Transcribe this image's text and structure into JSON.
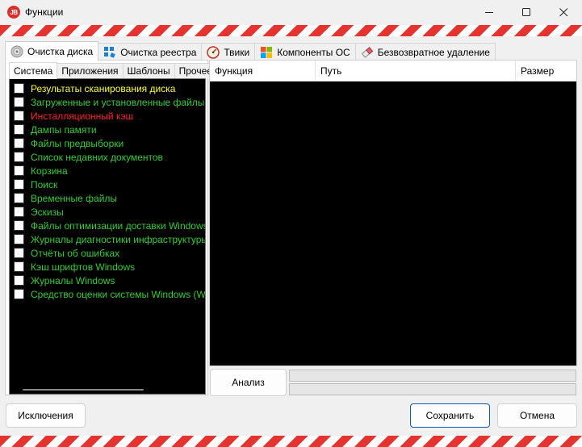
{
  "window": {
    "app_icon_text": "JB",
    "title": "Функции",
    "minimize_glyph": "—",
    "maximize_glyph": "☐",
    "close_glyph": "✕"
  },
  "main_tabs": [
    {
      "label": "Очистка диска",
      "icon": "disk-cleanup-icon",
      "active": true
    },
    {
      "label": "Очистка реестра",
      "icon": "registry-icon",
      "active": false
    },
    {
      "label": "Твики",
      "icon": "gauge-icon",
      "active": false
    },
    {
      "label": "Компоненты ОС",
      "icon": "windows-logo-icon",
      "active": false
    },
    {
      "label": "Безвозвратное удаление",
      "icon": "eraser-icon",
      "active": false
    }
  ],
  "sub_tabs": [
    {
      "label": "Система",
      "active": true
    },
    {
      "label": "Приложения",
      "active": false
    },
    {
      "label": "Шаблоны",
      "active": false
    },
    {
      "label": "Прочее",
      "active": false
    }
  ],
  "check_items": [
    {
      "label": "Результаты сканирования диска",
      "color": "#ffff33",
      "checked": false
    },
    {
      "label": "Загруженные и установленные файлы программ",
      "color": "#33cc33",
      "checked": false
    },
    {
      "label": "Инсталляционный кэш",
      "color": "#ff2222",
      "checked": false
    },
    {
      "label": "Дампы памяти",
      "color": "#33cc33",
      "checked": false
    },
    {
      "label": "Файлы предвыборки",
      "color": "#33cc33",
      "checked": false
    },
    {
      "label": "Список недавних документов",
      "color": "#33cc33",
      "checked": false
    },
    {
      "label": "Корзина",
      "color": "#33cc33",
      "checked": false
    },
    {
      "label": "Поиск",
      "color": "#33cc33",
      "checked": false
    },
    {
      "label": "Временные файлы",
      "color": "#33cc33",
      "checked": false
    },
    {
      "label": "Эскизы",
      "color": "#33cc33",
      "checked": false
    },
    {
      "label": "Файлы оптимизации доставки Windows",
      "color": "#33cc33",
      "checked": false
    },
    {
      "label": "Журналы диагностики инфраструктуры Windows",
      "color": "#33cc33",
      "checked": false
    },
    {
      "label": "Отчёты об ошибках",
      "color": "#33cc33",
      "checked": false
    },
    {
      "label": "Кэш шрифтов Windows",
      "color": "#33cc33",
      "checked": false
    },
    {
      "label": "Журналы Windows",
      "color": "#33cc33",
      "checked": false
    },
    {
      "label": "Средство оценки системы Windows (WinSAT)",
      "color": "#33cc33",
      "checked": false
    }
  ],
  "results_list": {
    "columns": [
      "Функция",
      "Путь",
      "Размер"
    ],
    "rows": []
  },
  "buttons": {
    "analyze": "Анализ",
    "exclusions": "Исключения",
    "save": "Сохранить",
    "cancel": "Отмена"
  },
  "colors": {
    "stripe_red": "#e53330",
    "list_background": "#000000",
    "accent_button_border": "#0b5cad"
  }
}
